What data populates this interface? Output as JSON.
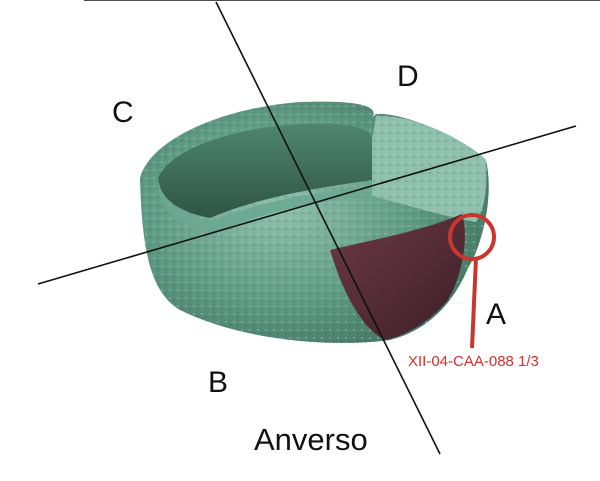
{
  "figure": {
    "labels": {
      "a": "A",
      "b": "B",
      "c": "C",
      "d": "D",
      "view": "Anverso",
      "sample_code": "XII-04-CAA-088 1/3"
    }
  },
  "colors": {
    "patina_green": "#5e9a84",
    "patina_light": "#8fc0ae",
    "patina_dark": "#3f6f5d",
    "corrosion_purple": "#5a2f3a",
    "marker_red": "#c8372d",
    "code_red": "#d6302a",
    "line": "#111111"
  }
}
